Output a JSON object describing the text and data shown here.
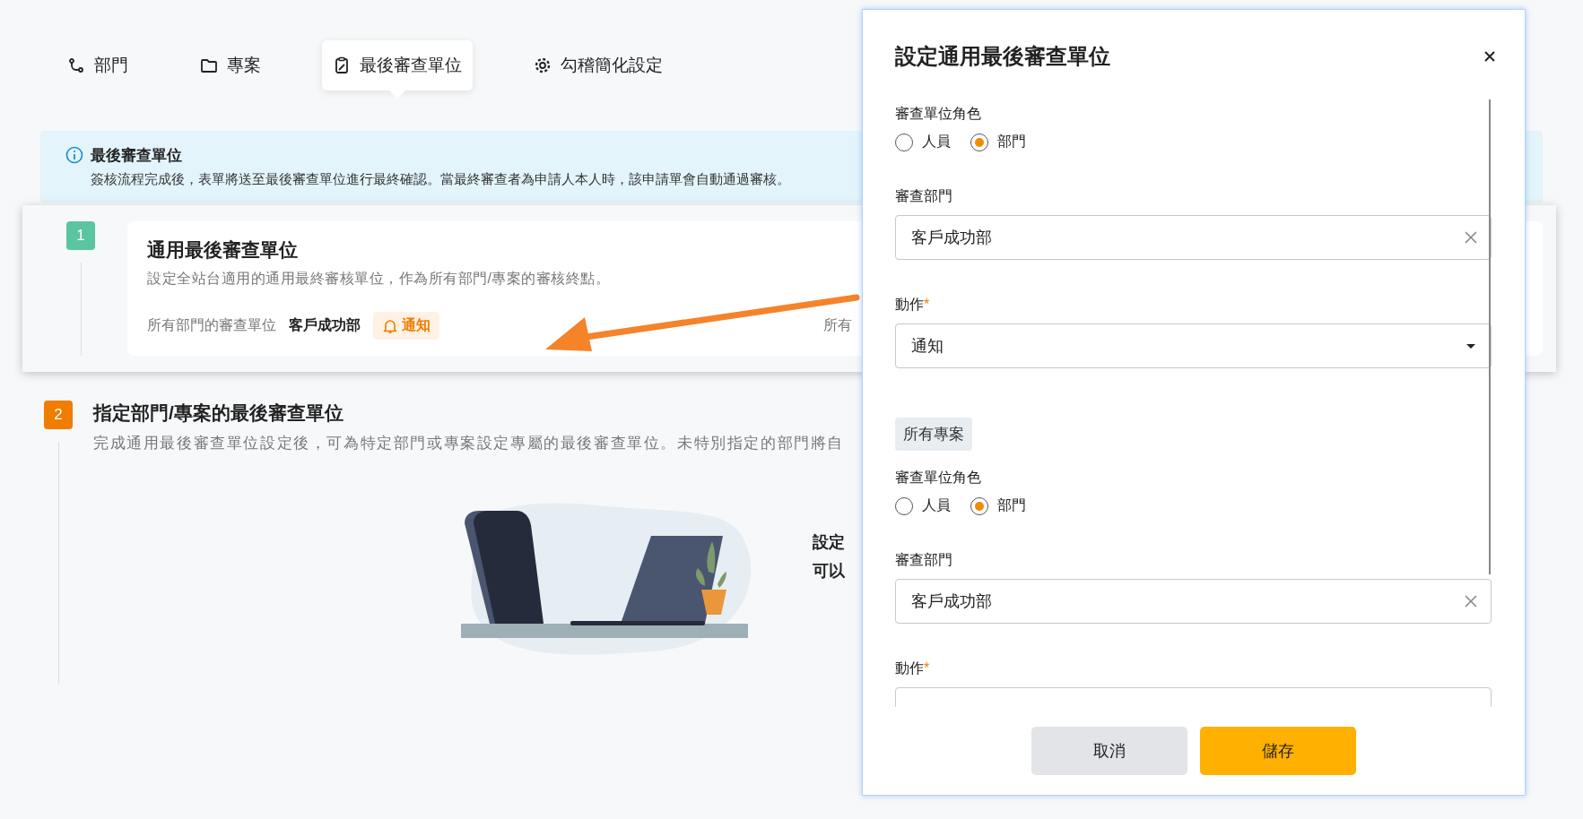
{
  "tabs": [
    {
      "label": "部門",
      "selected": false
    },
    {
      "label": "專案",
      "selected": false
    },
    {
      "label": "最後審查單位",
      "selected": true
    },
    {
      "label": "勾稽簡化設定",
      "selected": false
    }
  ],
  "banner": {
    "title": "最後審查單位",
    "text": "簽核流程完成後，表單將送至最後審查單位進行最終確認。當最終審查者為申請人本人時，該申請單會自動通過審核。"
  },
  "steps": [
    {
      "number": "1",
      "color": "#5bc4a0",
      "highlighted": true,
      "title": "通用最後審查單位",
      "description": "設定全站台適用的通用最終審核單位，作為所有部門/專案的審核終點。",
      "assignments": [
        {
          "label": "所有部門的審查單位",
          "value": "客戶成功部",
          "action": "通知"
        },
        {
          "label": "所有"
        }
      ]
    },
    {
      "number": "2",
      "color": "#f07c00",
      "highlighted": false,
      "title": "指定部門/專案的最後審查單位",
      "description": "完成通用最後審查單位設定後，可為特定部門或專案設定專屬的最後審查單位。未特別指定的部門將自",
      "empty_state": {
        "lines": [
          "設定",
          "可以"
        ]
      }
    }
  ],
  "modal": {
    "title": "設定通用最後審查單位",
    "sections": [
      {
        "fields": [
          {
            "kind": "radio",
            "label": "審查單位角色",
            "options": [
              {
                "label": "人員",
                "selected": false
              },
              {
                "label": "部門",
                "selected": true
              }
            ]
          },
          {
            "kind": "input",
            "label": "審查部門",
            "value": "客戶成功部",
            "clearable": true
          },
          {
            "kind": "select",
            "label": "動作",
            "required_mark": "*",
            "value": "通知"
          }
        ]
      },
      {
        "tag": "所有專案",
        "fields": [
          {
            "kind": "radio",
            "label": "審查單位角色",
            "options": [
              {
                "label": "人員",
                "selected": false
              },
              {
                "label": "部門",
                "selected": true
              }
            ]
          },
          {
            "kind": "input",
            "label": "審查部門",
            "value": "客戶成功部",
            "clearable": true
          },
          {
            "kind": "select",
            "label": "動作",
            "required_mark": "*"
          }
        ]
      }
    ],
    "buttons": [
      {
        "label": "取消",
        "kind": "secondary"
      },
      {
        "label": "儲存",
        "kind": "primary"
      }
    ]
  }
}
